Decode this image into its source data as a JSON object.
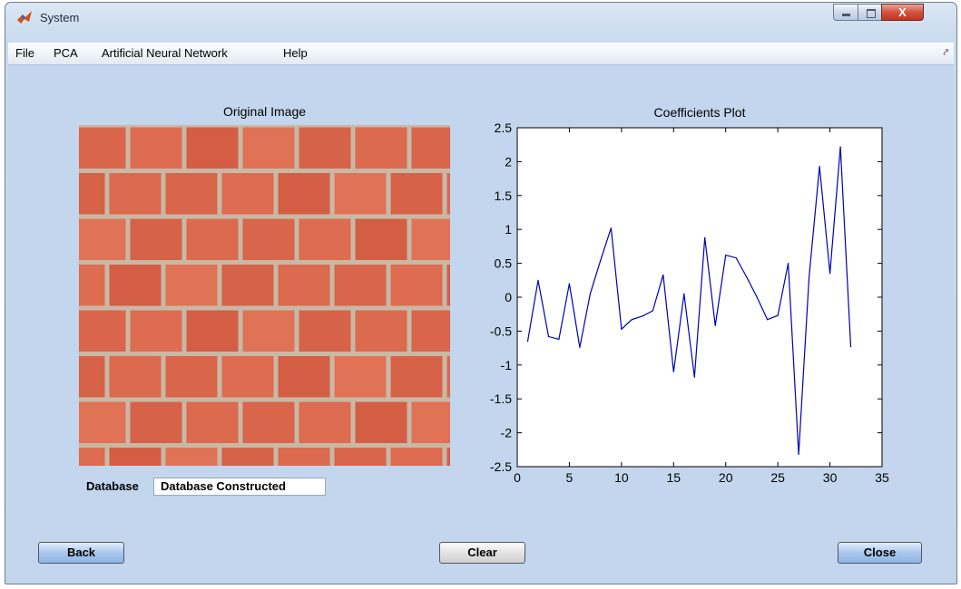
{
  "window": {
    "title": "System",
    "controls": {
      "minimize": "minimize",
      "maximize": "maximize",
      "close": "X"
    }
  },
  "menu": {
    "items": [
      "File",
      "PCA",
      "Artificial Neural Network",
      "Help"
    ]
  },
  "left_panel": {
    "title": "Original Image",
    "database_label": "Database",
    "database_value": "Database Constructed"
  },
  "buttons": {
    "back": "Back",
    "clear": "Clear",
    "close": "Close"
  },
  "colors": {
    "background": "#c3d6ee",
    "line": "#0000b4",
    "brick": "#d8654b",
    "mortar": "#c9b8a6"
  },
  "chart_data": {
    "type": "line",
    "title": "Coefficients Plot",
    "xlabel": "",
    "ylabel": "",
    "xlim": [
      0,
      35
    ],
    "ylim": [
      -2.5,
      2.5
    ],
    "xticks": [
      0,
      5,
      10,
      15,
      20,
      25,
      30,
      35
    ],
    "yticks": [
      2.5,
      2,
      1.5,
      1,
      0.5,
      0,
      -0.5,
      -1,
      -1.5,
      -2,
      -2.5
    ],
    "grid": false,
    "x": [
      1,
      2,
      3,
      4,
      5,
      6,
      7,
      8,
      9,
      10,
      11,
      12,
      13,
      14,
      15,
      16,
      17,
      18,
      19,
      20,
      21,
      22,
      23,
      24,
      25,
      26,
      27,
      28,
      29,
      30,
      31,
      32
    ],
    "y": [
      -0.65,
      0.25,
      -0.58,
      -0.62,
      0.2,
      -0.74,
      0.05,
      0.55,
      1.02,
      -0.47,
      -0.33,
      -0.28,
      -0.2,
      0.33,
      -1.1,
      0.05,
      -1.18,
      0.88,
      -0.42,
      0.62,
      0.58,
      0.3,
      0.0,
      -0.33,
      -0.27,
      0.5,
      -2.32,
      0.3,
      1.93,
      0.35,
      2.22,
      -0.73
    ]
  }
}
